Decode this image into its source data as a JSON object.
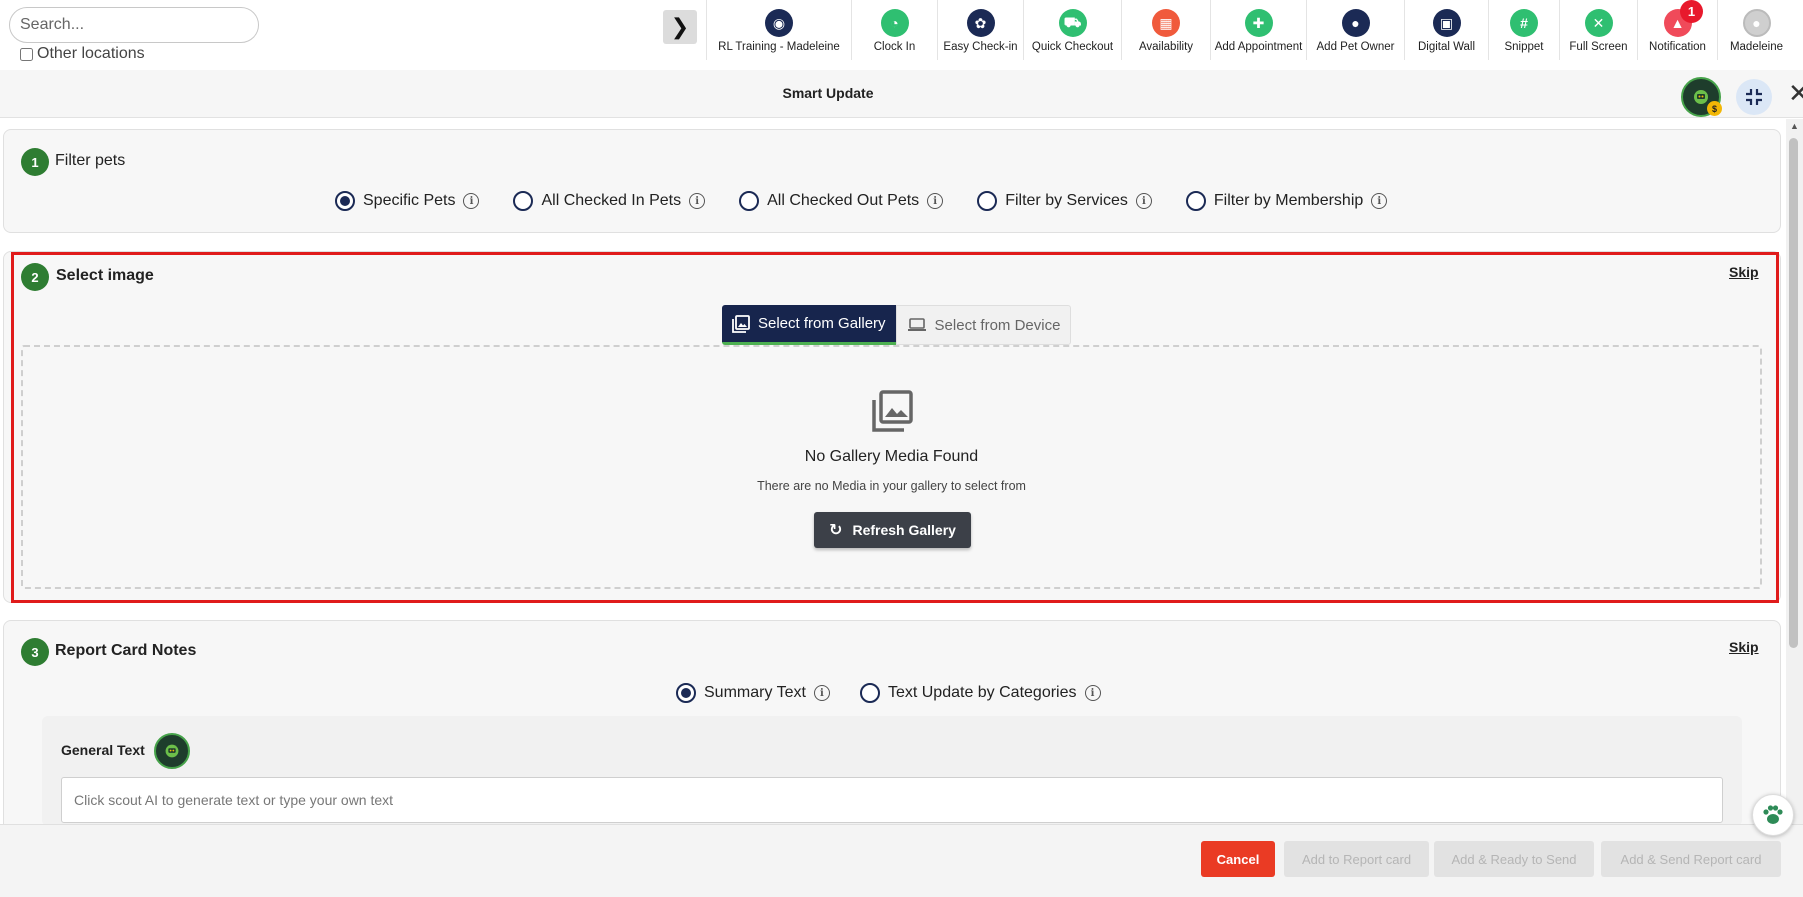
{
  "search": {
    "placeholder": "Search..."
  },
  "other_locations": "Other locations",
  "nav": [
    {
      "label": "RL Training - Madeleine",
      "icon": "map-pin-icon",
      "color": "#1b2a55",
      "glyph": "◉"
    },
    {
      "label": "Clock In",
      "icon": "clock-icon",
      "color": "#2fbf71",
      "glyph": "◔"
    },
    {
      "label": "Easy Check-in",
      "icon": "paw-icon",
      "color": "#1b2a55",
      "glyph": "✿"
    },
    {
      "label": "Quick Checkout",
      "icon": "cart-icon",
      "color": "#2fbf71",
      "glyph": "⛟"
    },
    {
      "label": "Availability",
      "icon": "calendar-icon",
      "color": "#f05a3c",
      "glyph": "▦"
    },
    {
      "label": "Add Appointment",
      "icon": "add-appointment-icon",
      "color": "#2fbf71",
      "glyph": "✚"
    },
    {
      "label": "Add Pet Owner",
      "icon": "add-user-icon",
      "color": "#1b2a55",
      "glyph": "●"
    },
    {
      "label": "Digital Wall",
      "icon": "monitor-icon",
      "color": "#1b2a55",
      "glyph": "▣"
    },
    {
      "label": "Snippet",
      "icon": "hash-icon",
      "color": "#2fbf71",
      "glyph": "#"
    },
    {
      "label": "Full Screen",
      "icon": "fullscreen-icon",
      "color": "#2fbf71",
      "glyph": "✕"
    },
    {
      "label": "Notification",
      "icon": "bell-icon",
      "color": "#f04a5a",
      "glyph": "▲"
    },
    {
      "label": "Madeleine",
      "icon": "avatar-icon",
      "color": "#cfcfcf",
      "glyph": "●"
    }
  ],
  "notification_count": "1",
  "header": {
    "title": "Smart Update"
  },
  "step1": {
    "number": "1",
    "title": "Filter pets",
    "options": [
      "Specific Pets",
      "All Checked In Pets",
      "All Checked Out Pets",
      "Filter by Services",
      "Filter by Membership"
    ],
    "selected": 0
  },
  "step2": {
    "number": "2",
    "title": "Select image",
    "skip": "Skip",
    "tabs": [
      "Select from Gallery",
      "Select from Device"
    ],
    "empty_title": "No Gallery Media Found",
    "empty_sub": "There are no Media in your gallery to select from",
    "refresh": "Refresh Gallery"
  },
  "step3": {
    "number": "3",
    "title": "Report Card Notes",
    "skip": "Skip",
    "options": [
      "Summary Text",
      "Text Update by Categories"
    ],
    "selected": 0,
    "general_label": "General Text",
    "placeholder": "Click scout AI to generate text or type your own text"
  },
  "footer": {
    "cancel": "Cancel",
    "add_report": "Add to Report card",
    "add_ready": "Add & Ready to Send",
    "add_send": "Add & Send Report card"
  },
  "colors": {
    "navy": "#17254d",
    "green": "#2e7d32",
    "highlight": "#e01b1b",
    "cancel": "#ea3b24"
  }
}
